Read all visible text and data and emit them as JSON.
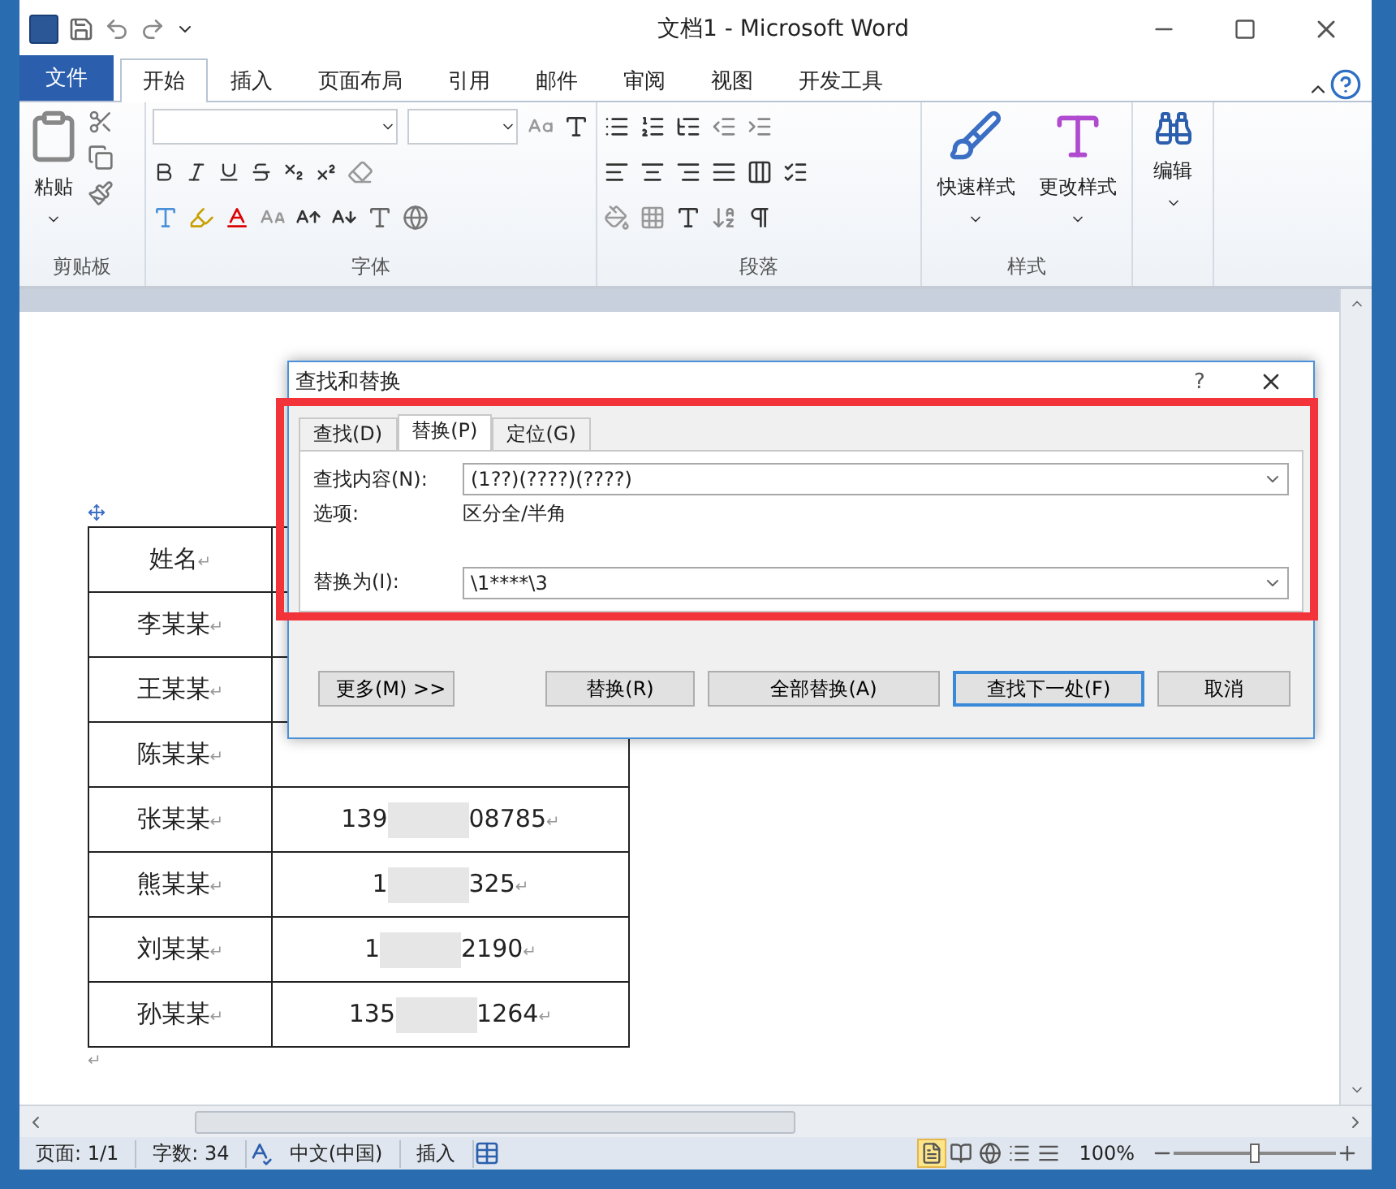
{
  "window": {
    "title": "文档1 - Microsoft Word"
  },
  "file_tab": "文件",
  "tabs": [
    {
      "label": "开始",
      "selected": true
    },
    {
      "label": "插入",
      "selected": false
    },
    {
      "label": "页面布局",
      "selected": false
    },
    {
      "label": "引用",
      "selected": false
    },
    {
      "label": "邮件",
      "selected": false
    },
    {
      "label": "审阅",
      "selected": false
    },
    {
      "label": "视图",
      "selected": false
    },
    {
      "label": "开发工具",
      "selected": false
    }
  ],
  "ribbon": {
    "clipboard": {
      "paste": "粘贴",
      "label": "剪贴板"
    },
    "font": {
      "label": "字体"
    },
    "paragraph": {
      "label": "段落"
    },
    "styles": {
      "quick": "快速样式",
      "change": "更改样式",
      "label": "样式"
    },
    "editing": {
      "label": "编辑"
    }
  },
  "table": {
    "paragraph_mark": "↵",
    "header": "姓名",
    "rows": [
      {
        "name": "李某某"
      },
      {
        "name": "王某某"
      },
      {
        "name": "陈某某"
      },
      {
        "name": "张某某",
        "phone_start": "139",
        "phone_end": "08785"
      },
      {
        "name": "熊某某",
        "phone_start": "1",
        "phone_end": "325"
      },
      {
        "name": "刘某某",
        "phone_start": "1",
        "phone_end": "2190"
      },
      {
        "name": "孙某某",
        "phone_start": "135",
        "phone_end": "1264"
      }
    ]
  },
  "dialog": {
    "title": "查找和替换",
    "help": "?",
    "tabs": [
      {
        "label": "查找(D)",
        "selected": false
      },
      {
        "label": "替换(P)",
        "selected": true
      },
      {
        "label": "定位(G)",
        "selected": false
      }
    ],
    "find_label": "查找内容(N):",
    "find_value": "(1??)(????)(????)",
    "options_label": "选项:",
    "options_value": "区分全/半角",
    "replace_label": "替换为(I):",
    "replace_value": "\\1****\\3",
    "buttons": [
      {
        "label": "更多(M) >>",
        "default": false
      },
      {
        "label": "替换(R)",
        "default": false
      },
      {
        "label": "全部替换(A)",
        "default": false
      },
      {
        "label": "查找下一处(F)",
        "default": true
      },
      {
        "label": "取消",
        "default": false
      }
    ]
  },
  "status_bar": {
    "page": "页面: 1/1",
    "words": "字数: 34",
    "language": "中文(中国)",
    "mode": "插入",
    "zoom": "100%",
    "level": 0.5
  }
}
